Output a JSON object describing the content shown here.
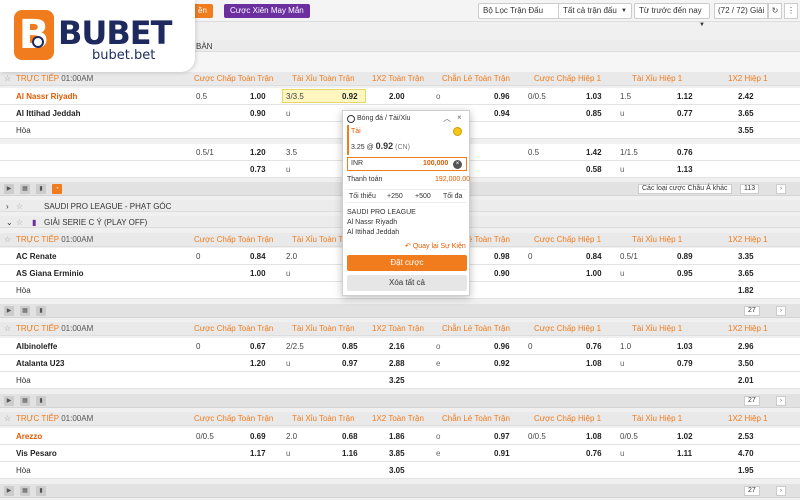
{
  "topbar": {
    "orange_label": "ền",
    "purple_label": "Cược Xiên May Mắn",
    "filter_label": "Bộ Lọc Trận Đấu",
    "all_matches_label": "Tất cả trận đấu",
    "sort_label": "Từ trước đến nay",
    "count_label": "(72 / 72) Giải"
  },
  "logo": {
    "brand": "BUBET",
    "sub": "bubet.bet"
  },
  "section_top": {
    "label": "BÀN"
  },
  "columns": {
    "ft_hdp": "Cược Chấp Toàn Trận",
    "ft_ou": "Tài Xỉu Toàn Trận",
    "ft_1x2": "1X2 Toàn Trận",
    "ft_oe": "Chẵn Lẻ Toàn Trận",
    "h1_hdp": "Cược Chấp Hiệp 1",
    "h1_ou": "Tài Xỉu Hiệp 1",
    "h1_1x2": "1X2 Hiệp 1"
  },
  "live_label": "TRỰC TIẾP",
  "draw_label": "Hòa",
  "u_label": "u",
  "o_label": "o",
  "e_label": "e",
  "match1": {
    "time": "01:00AM",
    "home": "Al Nassr Riyadh",
    "away": "Al Ittihad Jeddah",
    "r1": {
      "hdp": "0.5",
      "hdp_o": "1.00",
      "ou": "3/3.5",
      "ou_o": "0.92",
      "x": "2.00",
      "oe_o": "0.96",
      "h1hdp": "0/0.5",
      "h1hdp_o": "1.03",
      "h1ou": "1.5",
      "h1ou_o": "1.12",
      "h1x": "2.42"
    },
    "r2": {
      "hdp_o": "0.90",
      "oe_o": "0.94",
      "h1hdp_o": "0.85",
      "h1ou_o": "0.77",
      "h1x": "3.65"
    },
    "r3": {
      "h1x": "3.55"
    },
    "r4": {
      "hdp": "0.5/1",
      "hdp_o": "1.20",
      "ou": "3.5",
      "h1hdp": "0.5",
      "h1hdp_o": "1.42",
      "h1ou": "1/1.5",
      "h1ou_o": "0.76"
    },
    "r5": {
      "hdp_o": "0.73",
      "h1hdp_o": "0.58",
      "h1ou_o": "1.13"
    }
  },
  "footer1": {
    "select": "Các loại cược Châu Á khác",
    "page": "113"
  },
  "league_saudi": "SAUDI PRO LEAGUE - PHẠT GÓC",
  "league_serie": "GIẢI SERIE C Ý (PLAY OFF)",
  "match2": {
    "time": "01:00AM",
    "home": "AC Renate",
    "away": "AS Giana Erminio",
    "r1": {
      "hdp": "0",
      "hdp_o": "0.84",
      "ou": "2.0",
      "oe_o": "0.98",
      "h1hdp": "0",
      "h1hdp_o": "0.84",
      "h1ou": "0.5/1",
      "h1ou_o": "0.89",
      "h1x": "3.35"
    },
    "r2": {
      "hdp_o": "1.00",
      "oe_o": "0.90",
      "h1hdp_o": "1.00",
      "h1ou_o": "0.95",
      "h1x": "3.65"
    },
    "r3": {
      "h1x": "1.82"
    },
    "page": "27"
  },
  "match3": {
    "time": "01:00AM",
    "home": "Albinoleffe",
    "away": "Atalanta U23",
    "r1": {
      "hdp": "0",
      "hdp_o": "0.67",
      "ou": "2/2.5",
      "ou_o": "0.85",
      "x": "2.16",
      "oe_o": "0.96",
      "h1hdp": "0",
      "h1hdp_o": "0.76",
      "h1ou": "1.0",
      "h1ou_o": "1.03",
      "h1x": "2.96"
    },
    "r2": {
      "hdp_o": "1.20",
      "ou_o": "0.97",
      "x": "2.88",
      "oe_o": "0.92",
      "h1hdp_o": "1.08",
      "h1ou_o": "0.79",
      "h1x": "3.50"
    },
    "r3": {
      "x": "3.25",
      "h1x": "2.01"
    },
    "page": "27"
  },
  "match4": {
    "time": "01:00AM",
    "home": "Arezzo",
    "away": "Vis Pesaro",
    "r1": {
      "hdp": "0/0.5",
      "hdp_o": "0.69",
      "ou": "2.0",
      "ou_o": "0.68",
      "x": "1.86",
      "oe_o": "0.97",
      "h1hdp": "0/0.5",
      "h1hdp_o": "1.08",
      "h1ou": "0/0.5",
      "h1ou_o": "1.02",
      "h1x": "2.53"
    },
    "r2": {
      "hdp_o": "1.17",
      "ou_o": "1.16",
      "x": "3.85",
      "oe_o": "0.91",
      "h1hdp_o": "0.76",
      "h1ou_o": "1.11",
      "h1x": "4.70"
    },
    "r3": {
      "x": "3.05",
      "h1x": "1.95"
    },
    "page": "27"
  },
  "slip": {
    "title": "Bóng đá / Tài/Xỉu",
    "selection": "Tài",
    "line": "3.25 @",
    "odds": "0.92",
    "odds_type": "(CN)",
    "currency": "INR",
    "amount": "100,000",
    "pay_label": "Thanh toán",
    "pay_value": "192,000.00",
    "min_label": "Tối thiểu",
    "plus250": "+250",
    "plus500": "+500",
    "max_label": "Tối đa",
    "league": "SAUDI PRO LEAGUE",
    "team1": "Al Nassr Riyadh",
    "team2": "Al Ittihad Jeddah",
    "back_label": "Quay lại Sự Kiện",
    "place_label": "Đặt cược",
    "clear_label": "Xóa tất cả"
  }
}
